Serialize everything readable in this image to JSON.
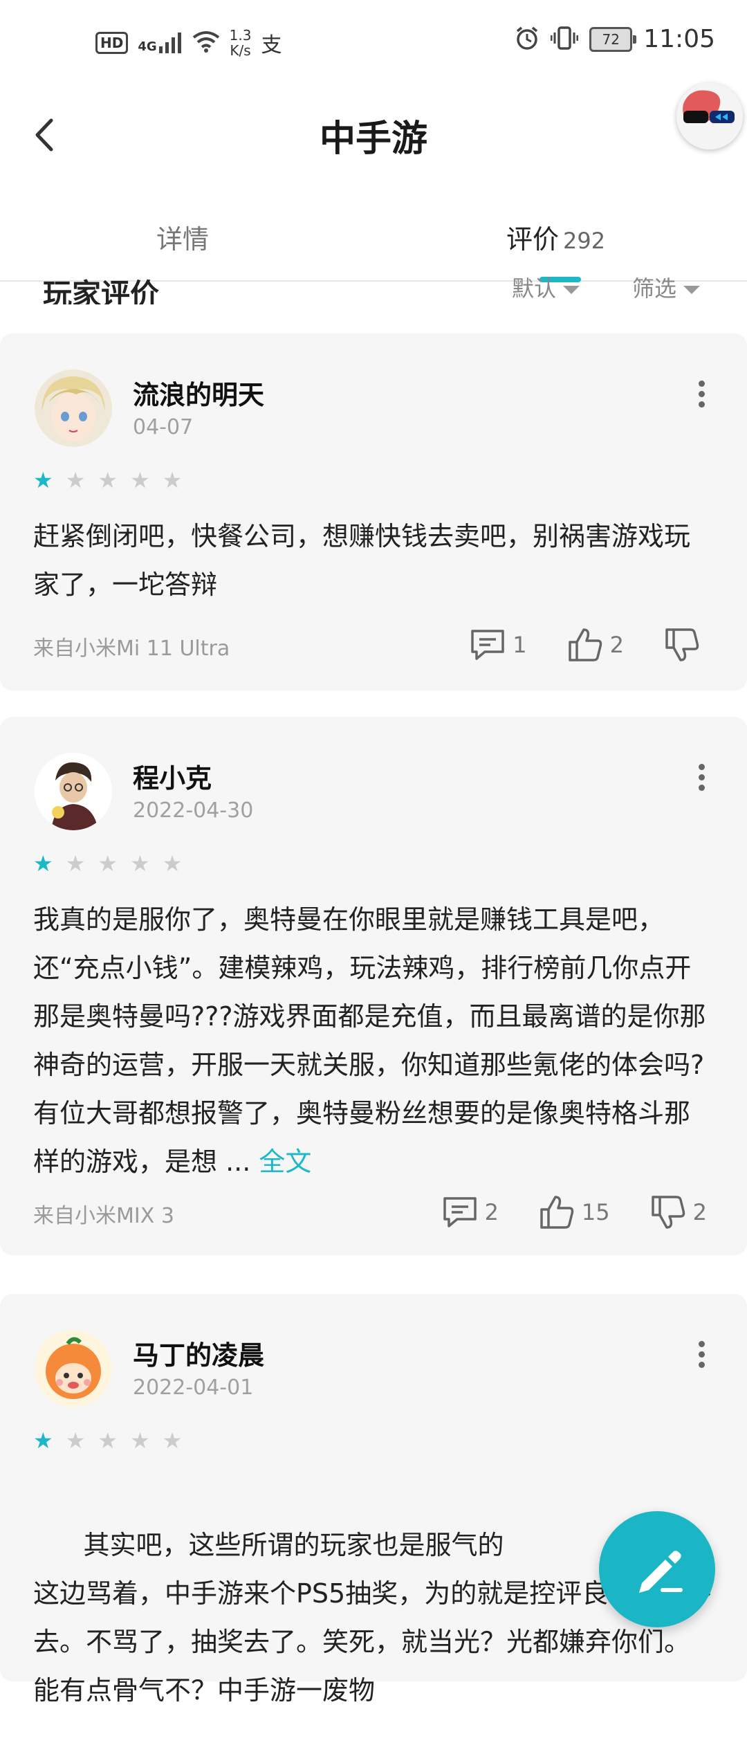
{
  "status_bar": {
    "left": {
      "hd": "HD",
      "network": "4G",
      "speed_value": "1.3",
      "speed_unit": "K/s",
      "app_icon": "支"
    },
    "right": {
      "battery": "72",
      "time": "11:05"
    }
  },
  "header": {
    "title": "中手游"
  },
  "tabs": [
    {
      "label": "详情",
      "count": ""
    },
    {
      "label": "评价",
      "count": "292"
    }
  ],
  "reviews_header": {
    "title": "玩家评价",
    "sort_label": "默认",
    "filter_label": "筛选"
  },
  "reviews": [
    {
      "username": "流浪的明天",
      "date": "04-07",
      "rating": 1,
      "text": "赶紧倒闭吧，快餐公司，想赚快钱去卖吧，别祸害游戏玩家了，一坨答辩",
      "full_link": "",
      "device": "来自小米Mi 11 Ultra",
      "comments": "1",
      "likes": "2",
      "dislikes": ""
    },
    {
      "username": "程小克",
      "date": "2022-04-30",
      "rating": 1,
      "text": "我真的是服你了，奥特曼在你眼里就是赚钱工具是吧，还“充点小钱”。建模辣鸡，玩法辣鸡，排行榜前几你点开那是奥特曼吗???游戏界面都是充值，而且最离谱的是你那神奇的运营，开服一天就关服，你知道那些氪佬的体会吗?有位大哥都想报警了，奥特曼粉丝想要的是像奥特格斗那样的游戏，是想 ... ",
      "full_link": "全文",
      "device": "来自小米MIX 3",
      "comments": "2",
      "likes": "15",
      "dislikes": "2"
    },
    {
      "username": "马丁的凌晨",
      "date": "2022-04-01",
      "rating": 1,
      "text": "其实吧，这些所谓的玩家也是服气的\n这边骂着，中手游来个PS5抽奖，为的就是控评良言论刷下去。不骂了，抽奖去了。笑死，就当光？光都嫌弃你们。能有点骨气不？中手游一废物",
      "full_link": "",
      "device": "",
      "comments": "",
      "likes": "",
      "dislikes": ""
    }
  ],
  "colors": {
    "accent": "#1cb8c8",
    "card_bg": "#f6f6f6",
    "muted": "#9a9a9a"
  }
}
